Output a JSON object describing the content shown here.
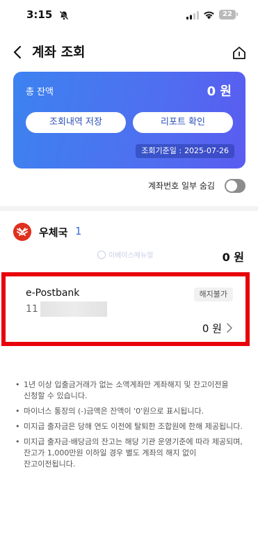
{
  "status_bar": {
    "time": "3:15",
    "battery": "22",
    "icons": [
      "bell-slash-icon",
      "signal-icon",
      "wifi-icon",
      "battery-icon"
    ]
  },
  "header": {
    "title": "계좌 조회",
    "back_icon": "chevron-left-icon",
    "home_icon": "home-icon"
  },
  "balance_card": {
    "label": "총 잔액",
    "amount": "0 원",
    "save_button": "조회내역 저장",
    "report_button": "리포트 확인",
    "base_date_label": "조회기준일 :",
    "base_date": "2025-07-26",
    "gradient_start": "#3d82f0",
    "gradient_end": "#5a5cf0"
  },
  "toggle": {
    "label": "계좌번호 일부 숨김",
    "on": false
  },
  "bank": {
    "name": "우체국",
    "count": "1",
    "total": "0 원",
    "logo_color": "#e0301e",
    "watermark": "이베이스매뉴얼"
  },
  "account": {
    "name": "e-Postbank",
    "badge": "해지불가",
    "number_prefix": "11",
    "amount": "0 원"
  },
  "notes": [
    "1년 이상 입출금거래가 없는 소액계좌만 계좌해지 및 잔고이전을 신청할 수 있습니다.",
    "마이너스 통장의 (-)금액은 잔액이 '0'원으로 표시됩니다.",
    "미지급 출자금은 당해 연도 이전에 탈퇴한 조합원에 한해 제공됩니다.",
    "미지급 출자금·배당금의 잔고는 해당 기관 운영기준에 따라 제공되며, 잔고가 1,000만원 이하일 경우 별도 계좌의 해지 없이 잔고이전됩니다."
  ],
  "colors": {
    "highlight": "#e8000b",
    "accent": "#3a6bd6"
  }
}
